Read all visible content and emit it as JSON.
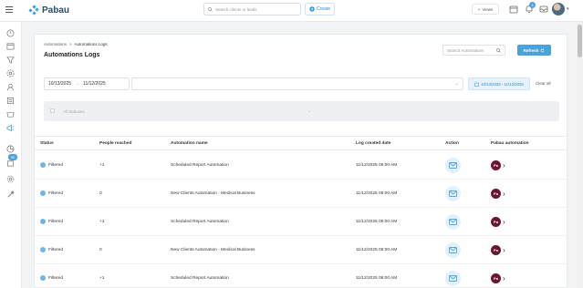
{
  "brand": {
    "name": "Pabau"
  },
  "topbar": {
    "search_placeholder": "Search clients or leads",
    "create_label": "Create",
    "views_label": "Views",
    "notifications_count": "8"
  },
  "sidebar": {
    "badge": "95"
  },
  "breadcrumb": {
    "parent": "Automations",
    "separator": ">",
    "current": "Automations Logs"
  },
  "page": {
    "title": "Automations Logs",
    "search_placeholder": "Search Automations",
    "refresh_label": "Refresh"
  },
  "filters": {
    "date_from": "10/13/2025",
    "date_arrow": "→",
    "date_to": "11/12/2025",
    "range_chip": "10/13/2025 - 11/12/2025",
    "clear_all": "Clear all",
    "status_placeholder": "All Statuses"
  },
  "table": {
    "columns": [
      "Status",
      "People reached",
      "Automation name",
      "Log created date",
      "Action",
      "Pabau automation"
    ],
    "rows": [
      {
        "status": "Filtered",
        "people": "+1",
        "name": "Scheduled Report Automation",
        "date": "11/12/2025 06:00 AM"
      },
      {
        "status": "Filtered",
        "people": "0",
        "name": "New Clients Automation - Medical Business",
        "date": "11/12/2025 06:00 AM"
      },
      {
        "status": "Filtered",
        "people": "+1",
        "name": "Scheduled Report Automation",
        "date": "11/12/2025 06:00 AM"
      },
      {
        "status": "Filtered",
        "people": "0",
        "name": "New Clients Automation - Medical Business",
        "date": "11/12/2025 06:00 AM"
      },
      {
        "status": "Filtered",
        "people": "+1",
        "name": "Scheduled Report Automation",
        "date": "11/12/2025 06:00 AM"
      }
    ],
    "pabau_badge": "Pa"
  },
  "colors": {
    "accent": "#48a3dc",
    "pabau_badge": "#6b1531",
    "status_dot": "#6fb5e7"
  }
}
